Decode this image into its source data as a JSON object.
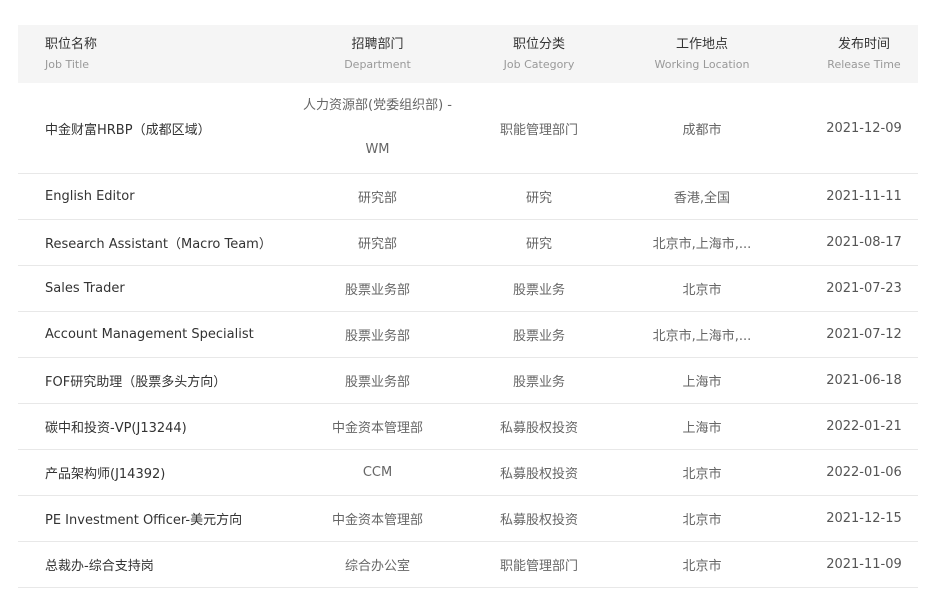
{
  "columns": [
    {
      "zh": "职位名称",
      "en": "Job Title"
    },
    {
      "zh": "招聘部门",
      "en": "Department"
    },
    {
      "zh": "职位分类",
      "en": "Job Category"
    },
    {
      "zh": "工作地点",
      "en": "Working Location"
    },
    {
      "zh": "发布时间",
      "en": "Release Time"
    }
  ],
  "rows": [
    {
      "title": "中金财富HRBP（成都区域）",
      "dept_line1": "人力资源部(党委组织部) -",
      "dept_line2": "WM",
      "category": "职能管理部门",
      "location": "成都市",
      "date": "2021-12-09"
    },
    {
      "title": "English Editor",
      "dept": "研究部",
      "category": "研究",
      "location": "香港,全国",
      "date": "2021-11-11"
    },
    {
      "title": "Research Assistant（Macro Team）",
      "dept": "研究部",
      "category": "研究",
      "location": "北京市,上海市,...",
      "date": "2021-08-17"
    },
    {
      "title": "Sales Trader",
      "dept": "股票业务部",
      "category": "股票业务",
      "location": "北京市",
      "date": "2021-07-23"
    },
    {
      "title": "Account Management Specialist",
      "dept": "股票业务部",
      "category": "股票业务",
      "location": "北京市,上海市,...",
      "date": "2021-07-12"
    },
    {
      "title": "FOF研究助理（股票多头方向）",
      "dept": "股票业务部",
      "category": "股票业务",
      "location": "上海市",
      "date": "2021-06-18"
    },
    {
      "title": "碳中和投资-VP(J13244)",
      "dept": "中金资本管理部",
      "category": "私募股权投资",
      "location": "上海市",
      "date": "2022-01-21"
    },
    {
      "title": "产品架构师(J14392)",
      "dept": "CCM",
      "category": "私募股权投资",
      "location": "北京市",
      "date": "2022-01-06"
    },
    {
      "title": "PE Investment Officer-美元方向",
      "dept": "中金资本管理部",
      "category": "私募股权投资",
      "location": "北京市",
      "date": "2021-12-15"
    },
    {
      "title": "总裁办-综合支持岗",
      "dept": "综合办公室",
      "category": "职能管理部门",
      "location": "北京市",
      "date": "2021-11-09"
    }
  ]
}
